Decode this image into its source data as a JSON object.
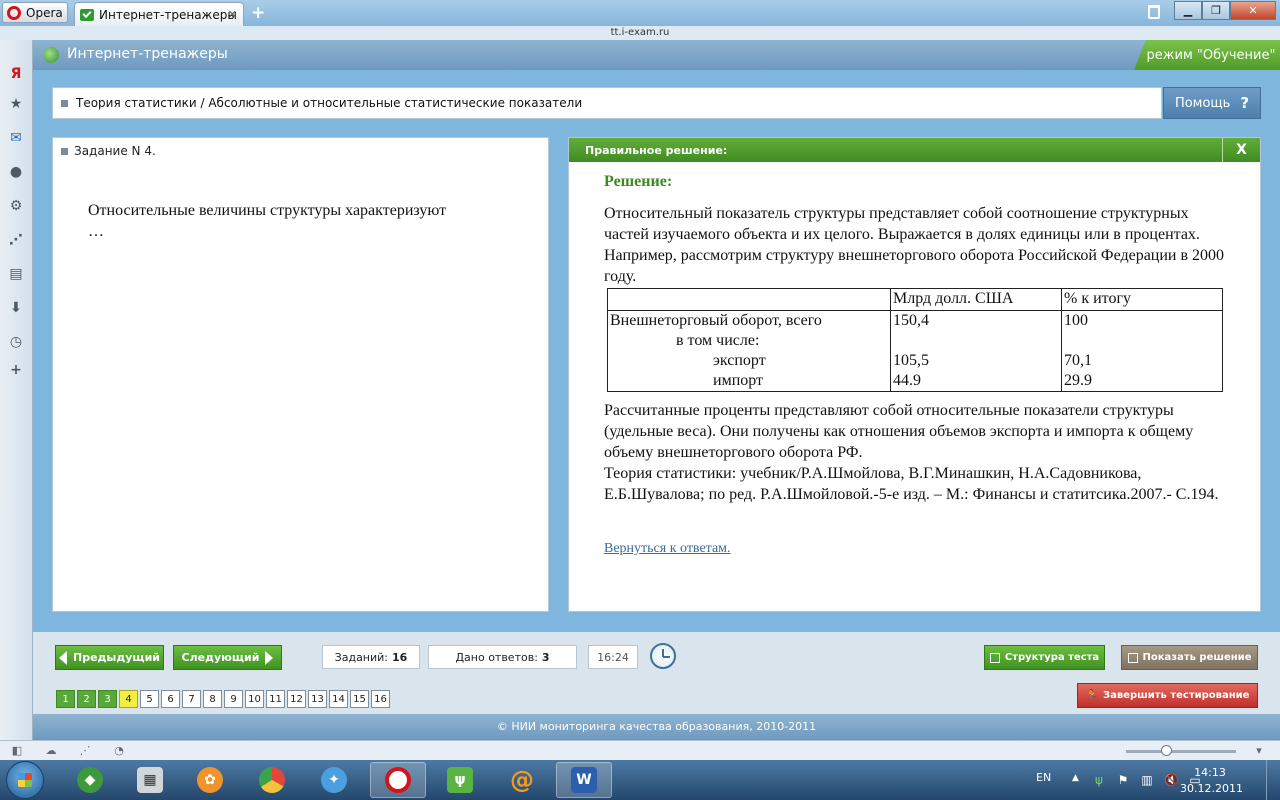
{
  "browser": {
    "menu_label": "Opera",
    "tab_title": "Интернет-тренажеры",
    "url": "tt.i-exam.ru"
  },
  "app": {
    "title": "Интернет-тренажеры",
    "mode": "режим \"Обучение\"",
    "breadcrumb": "Теория статистики / Абсолютные и относительные статистические показатели",
    "help_label": "Помощь",
    "help_glyph": "?"
  },
  "task": {
    "header": "Задание N 4.",
    "question_line1": "Относительные величины структуры характеризуют",
    "question_line2": "…"
  },
  "solution": {
    "header": "Правильное решение:",
    "close": "X",
    "title": "Решение:",
    "paragraph1": "Относительный показатель структуры представляет собой соотношение структурных частей изучаемого объекта и их целого. Выражается в долях единицы или в процентах. Например, рассмотрим структуру внешнеторгового оборота Российской Федерации в 2000 году.",
    "table": {
      "headers": [
        "",
        "Млрд долл. США",
        "% к итогу"
      ],
      "rows": [
        {
          "label": "Внешнеторговый оборот, всего",
          "v1": "150,4",
          "v2": "100"
        },
        {
          "label": "в том числе:",
          "v1": "",
          "v2": ""
        },
        {
          "label": "экспорт",
          "v1": "105,5",
          "v2": "70,1"
        },
        {
          "label": "импорт",
          "v1": "44.9",
          "v2": "29.9"
        }
      ]
    },
    "paragraph2": "Рассчитанные проценты представляют собой относительные показатели структуры (удельные веса). Они получены как отношения объемов экспорта и импорта к общему объему внешнеторгового оборота РФ.",
    "paragraph3": "Теория статистики: учебник/Р.А.Шмойлова, В.Г.Минашкин, Н.А.Садовникова, Е.Б.Шувалова; по ред. Р.А.Шмойловой.-5-е изд. – М.: Финансы и статитсика.2007.- С.194.",
    "back_link": "Вернуться к ответам."
  },
  "toolbar": {
    "prev_label": "Предыдущий",
    "next_label": "Следующий",
    "tasks_label": "Заданий:",
    "tasks_count": "16",
    "answers_label": "Дано ответов:",
    "answers_count": "3",
    "timer": "16:24",
    "structure_label": "Структура теста",
    "show_solution_label": "Показать решение",
    "finish_label": "Завершить тестирование",
    "question_numbers": [
      "1",
      "2",
      "3",
      "4",
      "5",
      "6",
      "7",
      "8",
      "9",
      "10",
      "11",
      "12",
      "13",
      "14",
      "15",
      "16"
    ],
    "answered": [
      1,
      2,
      3
    ],
    "current": 4
  },
  "footer": {
    "copyright": "© НИИ мониторинга качества образования, 2010-2011"
  },
  "taskbar": {
    "lang": "EN",
    "time": "14:13",
    "date": "30.12.2011"
  },
  "colors": {
    "green_accent": "#4f9c27",
    "header_blue": "#6e99bf",
    "current_question": "#f3ef3f",
    "finish_red": "#c1302a"
  }
}
